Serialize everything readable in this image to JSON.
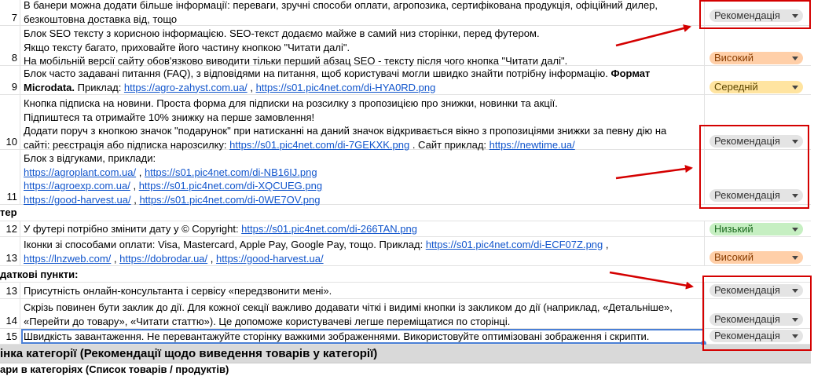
{
  "rows": {
    "r7": {
      "num": "7",
      "text": "В банери можна додати більше інформації: переваги, зручні способи оплати, агропозика, сертифікована продукція, офіційний дилер,\nбезкоштовна доставка від, тощо",
      "priority": "Рекомендація"
    },
    "r8": {
      "num": "8",
      "text": "Блок SEO тексту з корисною інформацією. SEO-текст додаємо майже в самий низ сторінки, перед футером.\nЯкщо тексту багато, приховайте його частину кнопкою \"Читати далі\".\nНа мобільній версії сайту обов'язково виводити тільки перший абзац SEO - тексту після чого кнопка \"Читати далі\".",
      "priority": "Високий"
    },
    "r9": {
      "num": "9",
      "text_a": "Блок часто задавані питання (FAQ), з відповідями на питання, щоб користувачі могли швидко знайти потрібну інформацію. ",
      "text_bold": "Формат Microdata.",
      "text_b": " Приклад: ",
      "link1": "https://agro-zahyst.com.ua/",
      "sep": " , ",
      "link2": "https://s01.pic4net.com/di-HYA0RD.png",
      "priority": "Середній"
    },
    "r10": {
      "num": "10",
      "text": "Кнопка підписка на новини. Проста форма для підписки на розсилку з пропозицією про знижки, новинки та акції.\nПідпиштеся та отримайте 10% знижку на перше замовлення!\nДодати поруч з кнопкою значок \"подарунок\" при натисканні на даний значок відкривається вікно з пропозиціями знижки за певну дію на\nсайті: реєстрація або підписка нарозсилку: ",
      "link1": "https://s01.pic4net.com/di-7GEKXK.png",
      "mid": " . Сайт приклад: ",
      "link2": "https://newtime.ua/",
      "priority": "Рекомендація"
    },
    "r11": {
      "num": "11",
      "title": "Блок з відгуками, приклади:",
      "links": [
        [
          "https://agroplant.com.ua/",
          "https://s01.pic4net.com/di-NB16IJ.png"
        ],
        [
          "https://agroexp.com.ua/",
          "https://s01.pic4net.com/di-XQCUEG.png"
        ],
        [
          "https://good-harvest.ua/",
          "https://s01.pic4net.com/di-0WE7OV.png"
        ]
      ],
      "sep": " , ",
      "priority": "Рекомендація"
    },
    "section_footer": "тер",
    "r12": {
      "num": "12",
      "text": "У футері потрібно змінити дату у © Copyright: ",
      "link1": "https://s01.pic4net.com/di-266TAN.png",
      "priority": "Низький"
    },
    "r13a": {
      "num": "13",
      "text": "Іконки зі способами оплати: Visa, Mastercard, Apple Pay, Google Pay, тощо. Приклад: ",
      "link1": "https://s01.pic4net.com/di-ECF07Z.png",
      "sep1": " ,",
      "link2": "https://lnzweb.com/",
      "sep2": " , ",
      "link3": "https://dobrodar.ua/",
      "sep3": " , ",
      "link4": "https://good-harvest.ua/",
      "priority": "Високий"
    },
    "section_extra": "даткові пункти:",
    "r13b": {
      "num": "13",
      "text": "Присутність онлайн-консультанта і сервісу «передзвонити мені».",
      "priority": "Рекомендація"
    },
    "r14": {
      "num": "14",
      "text": "Скрізь повинен бути заклик до дії. Для кожної секції важливо додавати чіткі і видимі кнопки із закликом до дії (наприклад, «Детальніше»,\n«Перейти до товару», «Читати статтю»). Це допоможе користувачеві легше переміщатися по сторінці.",
      "priority": "Рекомендація"
    },
    "r15": {
      "num": "15",
      "text": "Швидкість завантаження. Не перевантажуйте сторінку важкими зображеннями. Використовуйте оптимізовані зображення і скрипти.",
      "priority": "Рекомендація"
    }
  },
  "category_header": "інка категорії (Рекомендації щодо виведення товарів у категорії)",
  "subheader": "ари в категоріях (Список товарів / продуктів)",
  "colors": {
    "annotation_red": "#d40000",
    "link": "#1155cc",
    "selection": "#4a7fd6"
  }
}
